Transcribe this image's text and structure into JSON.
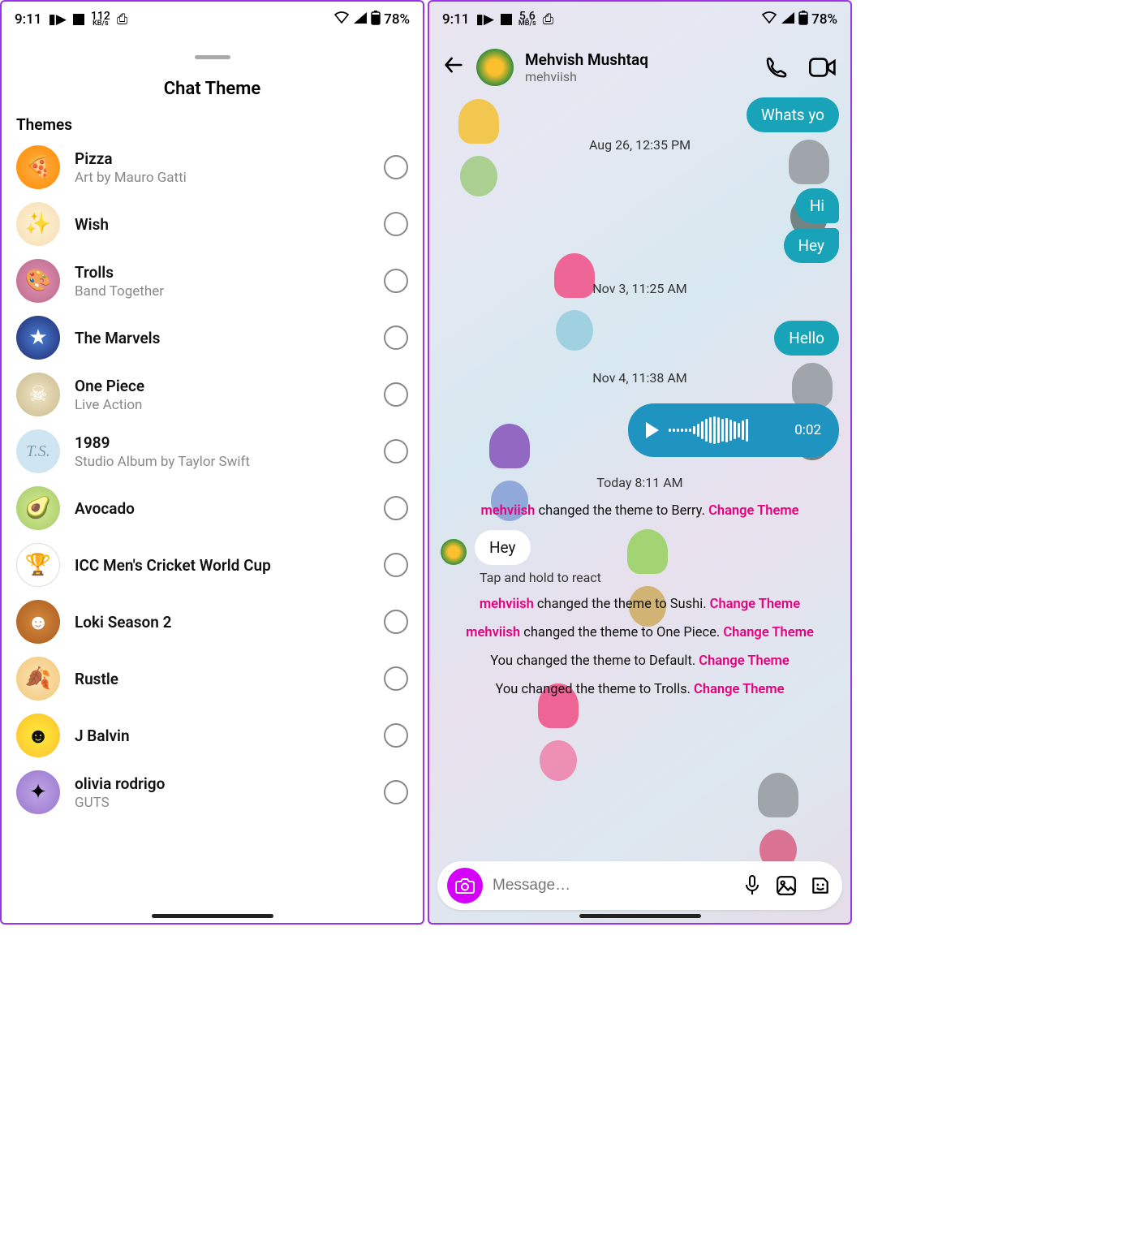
{
  "status": {
    "time": "9:11",
    "speed_left": "112",
    "speed_unit": "KB/s",
    "speed_right": "5.6",
    "speed_unit_right": "MB/s",
    "battery": "78%"
  },
  "left": {
    "title": "Chat Theme",
    "section": "Themes",
    "themes": [
      {
        "title": "Pizza",
        "sub": "Art by Mauro Gatti",
        "icon": "🍕"
      },
      {
        "title": "Wish",
        "sub": "",
        "icon": "✨"
      },
      {
        "title": "Trolls",
        "sub": "Band Together",
        "icon": "🎨"
      },
      {
        "title": "The Marvels",
        "sub": "",
        "icon": "★"
      },
      {
        "title": "One Piece",
        "sub": "Live Action",
        "icon": "☠"
      },
      {
        "title": "1989",
        "sub": "Studio Album by Taylor Swift",
        "icon": "T.S."
      },
      {
        "title": "Avocado",
        "sub": "",
        "icon": "🥑"
      },
      {
        "title": "ICC Men's Cricket World Cup",
        "sub": "",
        "icon": "🏆"
      },
      {
        "title": "Loki Season 2",
        "sub": "",
        "icon": "☻"
      },
      {
        "title": "Rustle",
        "sub": "",
        "icon": "🍂"
      },
      {
        "title": "J Balvin",
        "sub": "",
        "icon": "☻"
      },
      {
        "title": "olivia rodrigo",
        "sub": "GUTS",
        "icon": "✦"
      }
    ]
  },
  "right": {
    "header_name": "Mehvish Mushtaq",
    "header_username": "mehviish",
    "bubble_top": "Whats yo",
    "ts1": "Aug 26, 12:35 PM",
    "b_hi": "Hi",
    "b_hey": "Hey",
    "ts2": "Nov 3, 11:25 AM",
    "b_hello": "Hello",
    "ts3": "Nov 4, 11:38 AM",
    "voice_time": "0:02",
    "ts4": "Today 8:11 AM",
    "sys1_user": "mehviish",
    "sys1_mid": " changed the theme to Berry. ",
    "sys_action": "Change Theme",
    "in_hey": "Hey",
    "react_hint": "Tap and hold to react",
    "sys2_user": "mehviish",
    "sys2_mid": " changed the theme to Sushi. ",
    "sys3_user": "mehviish",
    "sys3_mid": " changed the theme to One Piece. ",
    "sys4_pre": "You changed the theme to Default. ",
    "sys5_pre": "You changed the theme to Trolls. ",
    "composer_placeholder": "Message…"
  }
}
